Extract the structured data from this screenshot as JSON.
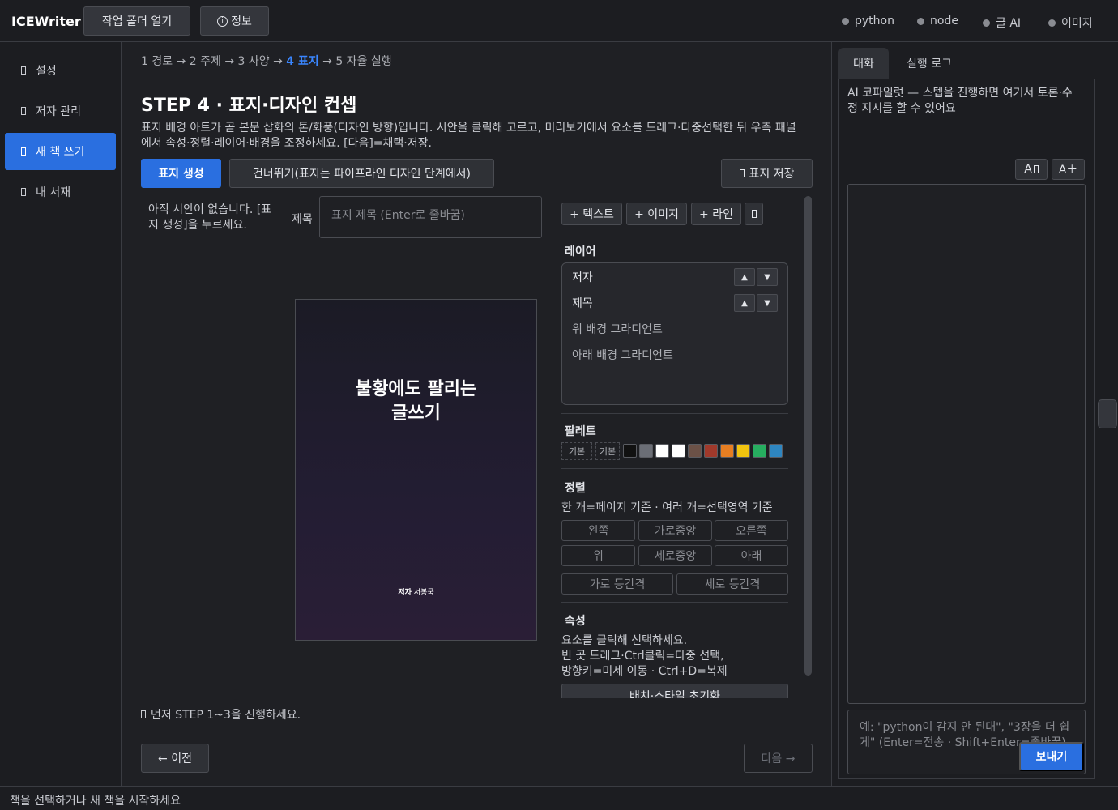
{
  "app": {
    "title": "ICEWriter"
  },
  "topbar": {
    "open_folder": "작업 폴더 열기",
    "info": "정보",
    "status": [
      {
        "label": "python"
      },
      {
        "label": "node"
      },
      {
        "label": "글 AI"
      },
      {
        "label": "이미지"
      }
    ]
  },
  "sidebar": {
    "items": [
      {
        "label": "설정",
        "active": false
      },
      {
        "label": "저자 관리",
        "active": false
      },
      {
        "label": "새 책 쓰기",
        "active": true
      },
      {
        "label": "내 서재",
        "active": false
      }
    ]
  },
  "breadcrumb": {
    "s1": "1 경로",
    "s2": "2 주제",
    "s3": "3 사양",
    "s4": "4 표지",
    "s5": "5 자율 실행",
    "sep": "→"
  },
  "step": {
    "title": "STEP 4 · 표지·디자인 컨셉",
    "description": "표지 배경 아트가 곧 본문 삽화의 톤/화풍(디자인 방향)입니다. 시안을 클릭해 고르고, 미리보기에서 요소를 드래그·다중선택한 뒤 우측 패널에서 속성·정렬·레이어·배경을 조정하세요. [다음]=채택·저장."
  },
  "actions": {
    "generate": "표지 생성",
    "skip": "건너뛰기(표지는 파이프라인 디자인 단계에서)",
    "save": "표지 저장"
  },
  "drafts": {
    "empty": "아직 시안이 없습니다. [표지 생성]을 누르세요."
  },
  "title_field": {
    "label": "제목",
    "placeholder": "표지 제목 (Enter로 줄바꿈)"
  },
  "cover": {
    "title_line1": "불황에도 팔리는",
    "title_line2": "글쓰기",
    "author_label": "저자",
    "author_name": "서봉국"
  },
  "editor": {
    "add_text": "+ 텍스트",
    "add_image": "+ 이미지",
    "add_line": "+ 라인",
    "layers_title": "레이어",
    "layers": [
      {
        "name": "저자"
      },
      {
        "name": "제목"
      },
      {
        "name": "위 배경 그라디언트"
      },
      {
        "name": "아래 배경 그라디언트"
      }
    ],
    "palette_title": "팔레트",
    "palette_tags": [
      "기본",
      "기본"
    ],
    "palette_colors": [
      "#111111",
      "#6b6e76",
      "#ffffff",
      "#ffffff",
      "#6b5147",
      "#a0392b",
      "#e67e22",
      "#f1c40f",
      "#27ae60",
      "#2e86c1"
    ],
    "align_title": "정렬",
    "align_hint": "한 개=페이지 기준 · 여러 개=선택영역 기준",
    "align": {
      "left": "왼쪽",
      "hcenter": "가로중앙",
      "right": "오른쪽",
      "top": "위",
      "vcenter": "세로중앙",
      "bottom": "아래",
      "hspace": "가로 등간격",
      "vspace": "세로 등간격"
    },
    "props_title": "속성",
    "props_hint1": "요소를 클릭해 선택하세요.",
    "props_hint2": "빈 곳 드래그·Ctrl클릭=다중 선택,",
    "props_hint3": "방향키=미세 이동 · Ctrl+D=복제",
    "reset": "배치·스타일 초기화"
  },
  "notice": "먼저 STEP 1~3을 진행하세요.",
  "nav": {
    "prev": "← 이전",
    "next": "다음 →"
  },
  "right": {
    "tab_chat": "대화",
    "tab_log": "실행 로그",
    "hint": "AI 코파일럿 — 스텝을 진행하면 여기서 토론·수정 지시를 할 수 있어요",
    "font_smaller": "A",
    "font_larger": "A＋",
    "input_placeholder": "예: \"python이 감지 안 된대\", \"3장을 더 쉽게\" (Enter=전송 · Shift+Enter=줄바꿈)",
    "send": "보내기"
  },
  "statusbar": {
    "text": "책을 선택하거나 새 책을 시작하세요"
  }
}
